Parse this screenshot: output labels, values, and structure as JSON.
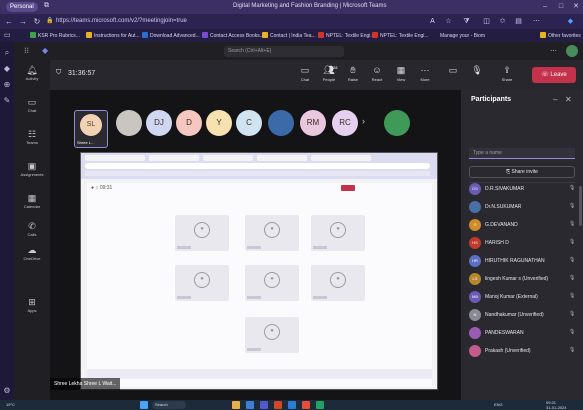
{
  "browser": {
    "profile_label": "Personal",
    "tab_title": "Digital Marketing and Fashion Branding | Microsoft Teams",
    "url": "https://teams.microsoft.com/v2/?meetingjoin=true",
    "bookmarks": [
      "KSR Pro Rubrics...",
      "Instructions for Aut...",
      "Download Advanced...",
      "Contact Access Books...",
      "Contact | India Tea...",
      "NPTEL: Textile Engi...",
      "NPTEL: Textile Engi...",
      "Manage your - Biom",
      "Other favorites"
    ],
    "bookmark_colors": [
      "#3aa34a",
      "#e6b422",
      "#2a6fc9",
      "#7a4bd6",
      "#e6b422",
      "#d0342c",
      "#d0342c",
      "#2a6fc9",
      "#e6b422"
    ]
  },
  "teams": {
    "search_placeholder": "Search (Ctrl+Alt+E)",
    "rail": [
      {
        "label": "Activity",
        "icon": "bell-icon"
      },
      {
        "label": "Chat",
        "icon": "chat-icon"
      },
      {
        "label": "Teams",
        "icon": "teams-icon"
      },
      {
        "label": "Assignments",
        "icon": "assignment-icon"
      },
      {
        "label": "Calendar",
        "icon": "calendar-icon"
      },
      {
        "label": "Calls",
        "icon": "phone-icon"
      },
      {
        "label": "OneDrive",
        "icon": "cloud-icon"
      },
      {
        "label": "Apps",
        "icon": "apps-icon"
      }
    ]
  },
  "meeting": {
    "timer": "31:36:57",
    "controls": [
      {
        "label": "Chat",
        "icon": "chat-icon"
      },
      {
        "label": "People",
        "icon": "people-icon",
        "badge": "28"
      },
      {
        "label": "Raise",
        "icon": "hand-icon"
      },
      {
        "label": "React",
        "icon": "smile-icon"
      },
      {
        "label": "View",
        "icon": "grid-icon"
      },
      {
        "label": "More",
        "icon": "more-icon"
      },
      {
        "label": "",
        "icon": "camera-icon"
      },
      {
        "label": "",
        "icon": "mic-icon"
      },
      {
        "label": "Share",
        "icon": "share-icon"
      }
    ],
    "leave_label": "Leave",
    "my_tile": {
      "initials": "SL",
      "name": "Shree L..."
    },
    "strip": [
      {
        "initials": "",
        "color": "#c9c6c2",
        "photo": true
      },
      {
        "initials": "DJ",
        "color": "#cfd8f0"
      },
      {
        "initials": "D",
        "color": "#f4c7c0"
      },
      {
        "initials": "Y",
        "color": "#f6e2b0"
      },
      {
        "initials": "C",
        "color": "#cfe3f1"
      },
      {
        "initials": "",
        "color": "#3b6aa8",
        "photo": true
      },
      {
        "initials": "RM",
        "color": "#e9c7de"
      },
      {
        "initials": "RC",
        "color": "#e5d0ef"
      },
      {
        "initials": "",
        "color": "#3f9a5a",
        "photo": true
      }
    ],
    "presenter_label": "Shree Lekha Shree L Wait..."
  },
  "participants": {
    "title": "Participants",
    "search_placeholder": "Type a name",
    "share_invite": "Share invite",
    "list": [
      {
        "initials": "DS",
        "name": "D.R.SIVAKUMAR",
        "color": "#6b5bb5"
      },
      {
        "initials": "",
        "name": "Dr.N.SUKUMAR",
        "color": "#4a6fa5"
      },
      {
        "initials": "G",
        "name": "G.DEVANAND",
        "color": "#d08a2a"
      },
      {
        "initials": "HS",
        "name": "HARISH D",
        "color": "#c0392b"
      },
      {
        "initials": "HR",
        "name": "HIRUTHIK RAGUNATHAN",
        "color": "#5b6fc5"
      },
      {
        "initials": "LS",
        "name": "lingesh Kumar s (Unverified)",
        "color": "#b8862c"
      },
      {
        "initials": "MB",
        "name": "Manoj Kumar (External)",
        "color": "#6b5bb5"
      },
      {
        "initials": "N",
        "name": "Nandhakumar (Unverified)",
        "color": "#8a8a94"
      },
      {
        "initials": "",
        "name": "PANDESWARAN",
        "color": "#9a5bb5"
      },
      {
        "initials": "",
        "name": "Prakash (Unverified)",
        "color": "#c45b8a"
      }
    ]
  },
  "taskbar": {
    "weather": "19°C",
    "search": "Search",
    "lang": "ENG",
    "time": "09:31",
    "date": "31-01-2024"
  }
}
